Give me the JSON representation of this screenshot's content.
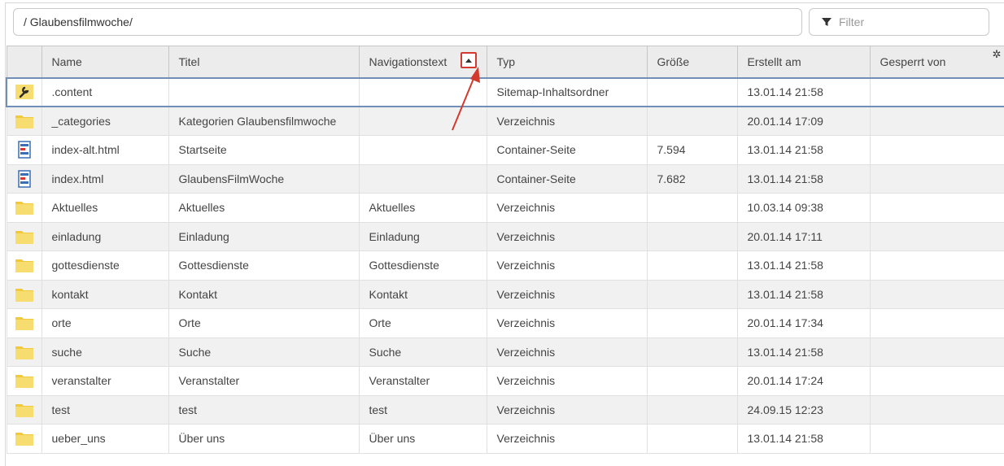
{
  "path": "/ Glaubensfilmwoche/",
  "filter": {
    "placeholder": "Filter"
  },
  "columns": [
    "Name",
    "Titel",
    "Navigationstext",
    "Typ",
    "Größe",
    "Erstellt am",
    "Gesperrt von"
  ],
  "rows": [
    {
      "icon": "wrench-folder-icon",
      "name": ".content",
      "titel": "",
      "nav": "",
      "typ": "Sitemap-Inhaltsordner",
      "groesse": "",
      "erstellt": "13.01.14 21:58",
      "gesperrt": ""
    },
    {
      "icon": "folder-icon",
      "name": "_categories",
      "titel": "Kategorien Glaubensfilmwoche",
      "nav": "",
      "typ": "Verzeichnis",
      "groesse": "",
      "erstellt": "20.01.14 17:09",
      "gesperrt": ""
    },
    {
      "icon": "container-page-icon",
      "name": "index-alt.html",
      "titel": "Startseite",
      "nav": "",
      "typ": "Container-Seite",
      "groesse": "7.594",
      "erstellt": "13.01.14 21:58",
      "gesperrt": ""
    },
    {
      "icon": "container-page-icon",
      "name": "index.html",
      "titel": "GlaubensFilmWoche",
      "nav": "",
      "typ": "Container-Seite",
      "groesse": "7.682",
      "erstellt": "13.01.14 21:58",
      "gesperrt": ""
    },
    {
      "icon": "folder-icon",
      "name": "Aktuelles",
      "titel": "Aktuelles",
      "nav": "Aktuelles",
      "typ": "Verzeichnis",
      "groesse": "",
      "erstellt": "10.03.14 09:38",
      "gesperrt": ""
    },
    {
      "icon": "folder-icon",
      "name": "einladung",
      "titel": "Einladung",
      "nav": "Einladung",
      "typ": "Verzeichnis",
      "groesse": "",
      "erstellt": "20.01.14 17:11",
      "gesperrt": ""
    },
    {
      "icon": "folder-icon",
      "name": "gottesdienste",
      "titel": "Gottesdienste",
      "nav": "Gottesdienste",
      "typ": "Verzeichnis",
      "groesse": "",
      "erstellt": "13.01.14 21:58",
      "gesperrt": ""
    },
    {
      "icon": "folder-icon",
      "name": "kontakt",
      "titel": "Kontakt",
      "nav": "Kontakt",
      "typ": "Verzeichnis",
      "groesse": "",
      "erstellt": "13.01.14 21:58",
      "gesperrt": ""
    },
    {
      "icon": "folder-icon",
      "name": "orte",
      "titel": "Orte",
      "nav": "Orte",
      "typ": "Verzeichnis",
      "groesse": "",
      "erstellt": "20.01.14 17:34",
      "gesperrt": ""
    },
    {
      "icon": "folder-icon",
      "name": "suche",
      "titel": "Suche",
      "nav": "Suche",
      "typ": "Verzeichnis",
      "groesse": "",
      "erstellt": "13.01.14 21:58",
      "gesperrt": ""
    },
    {
      "icon": "folder-icon",
      "name": "veranstalter",
      "titel": "Veranstalter",
      "nav": "Veranstalter",
      "typ": "Verzeichnis",
      "groesse": "",
      "erstellt": "20.01.14 17:24",
      "gesperrt": ""
    },
    {
      "icon": "folder-icon",
      "name": "test",
      "titel": "test",
      "nav": "test",
      "typ": "Verzeichnis",
      "groesse": "",
      "erstellt": "24.09.15 12:23",
      "gesperrt": ""
    },
    {
      "icon": "folder-icon",
      "name": "ueber_uns",
      "titel": "Über uns",
      "nav": "Über uns",
      "typ": "Verzeichnis",
      "groesse": "",
      "erstellt": "13.01.14 21:58",
      "gesperrt": ""
    }
  ],
  "colors": {
    "selected_border": "#6f8fb8",
    "annotation": "#d23a2e",
    "folder": "#f5d35e",
    "header_bg": "#ececec",
    "zebra": "#f1f1f1"
  }
}
